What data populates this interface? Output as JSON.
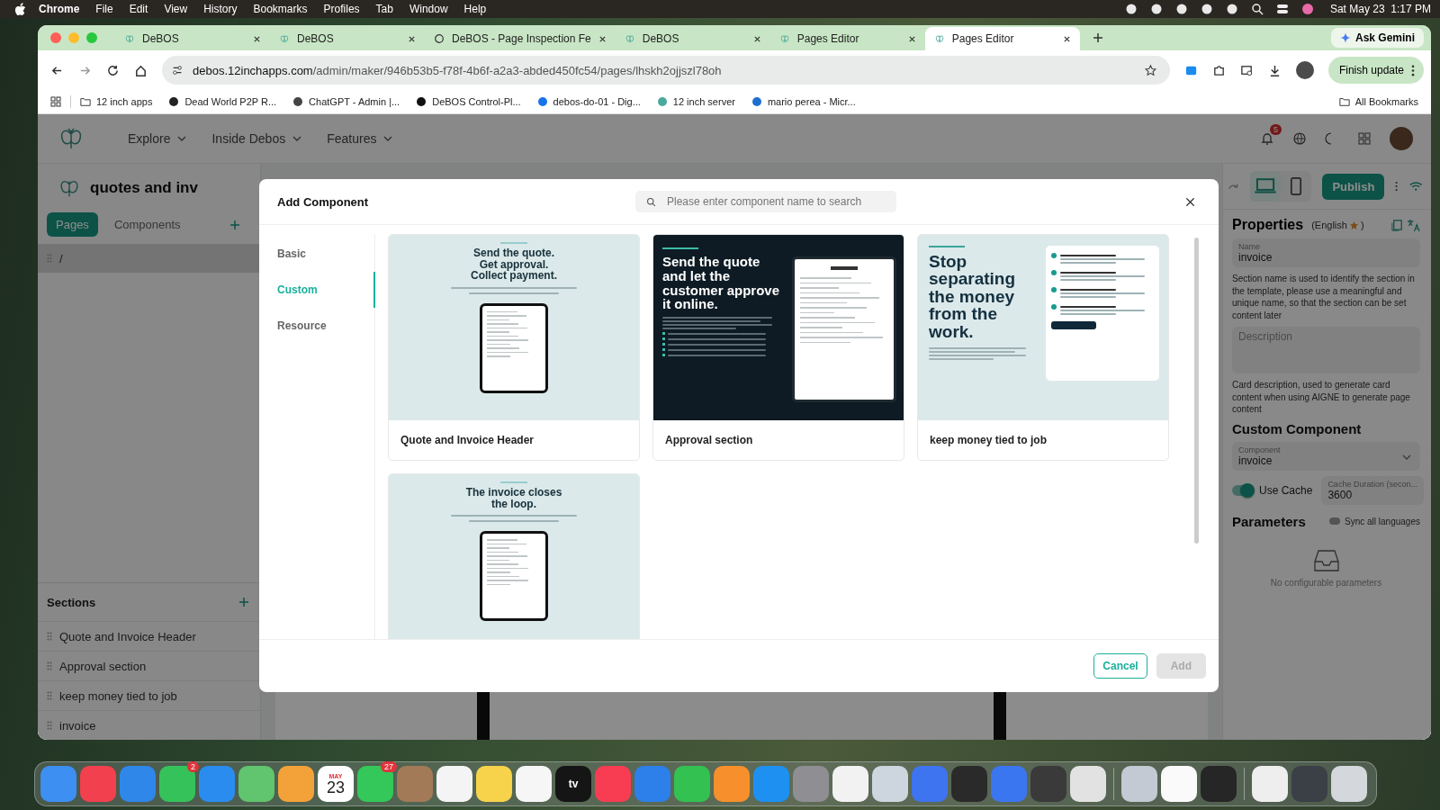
{
  "menu_bar": {
    "app": "Chrome",
    "menus": [
      "File",
      "Edit",
      "View",
      "History",
      "Bookmarks",
      "Profiles",
      "Tab",
      "Window",
      "Help"
    ],
    "clock": "Sat May 23  1:17 PM"
  },
  "browser": {
    "tabs": [
      {
        "label": "DeBOS",
        "selected": false
      },
      {
        "label": "DeBOS",
        "selected": false
      },
      {
        "label": "DeBOS - Page Inspection Fe",
        "selected": false
      },
      {
        "label": "DeBOS",
        "selected": false
      },
      {
        "label": "Pages Editor",
        "selected": false
      },
      {
        "label": "Pages Editor",
        "selected": true
      }
    ],
    "ask_gemini": "Ask Gemini",
    "url_host": "debos.12inchapps.com",
    "url_path": "/admin/maker/946b53b5-f78f-4b6f-a2a3-abded450fc54/pages/lhskh2ojjszl78oh",
    "finish_update": "Finish update",
    "bookmarks": [
      "12 inch apps",
      "Dead World P2P R...",
      "ChatGPT - Admin |...",
      "DeBOS Control-Pl...",
      "debos-do-01 - Dig...",
      "12 inch server",
      "mario perea - Micr..."
    ],
    "all_bookmarks": "All Bookmarks"
  },
  "header": {
    "nav": [
      "Explore",
      "Inside Debos",
      "Features"
    ],
    "notification_count": "5"
  },
  "left_panel": {
    "site_title": "quotes and inv",
    "tabs": [
      {
        "label": "Pages",
        "selected": true
      },
      {
        "label": "Components",
        "selected": false
      }
    ],
    "pages": [
      {
        "label": "/",
        "selected": true
      }
    ],
    "sections_title": "Sections",
    "sections": [
      "Quote and Invoice Header",
      "Approval section",
      "keep money tied to job",
      "invoice"
    ]
  },
  "right_panel": {
    "publish": "Publish",
    "title": "Properties",
    "language": "(English",
    "language_end": ")",
    "name_field": {
      "label": "Name",
      "value": "invoice"
    },
    "name_help": "Section name is used to identify the section in the template, please use a meaningful and unique name, so that the section can be set content later",
    "description_field": {
      "placeholder": "Description"
    },
    "description_help": "Card description, used to generate card content when using AIGNE to generate page content",
    "custom_title": "Custom Component",
    "component_field": {
      "label": "Component",
      "value": "invoice"
    },
    "use_cache": {
      "label": "Use Cache",
      "on": true
    },
    "cache_field": {
      "label": "Cache Duration (secon...",
      "value": "3600"
    },
    "parameters_title": "Parameters",
    "sync": {
      "label": "Sync all languages",
      "on": false
    },
    "empty_text": "No configurable parameters"
  },
  "modal": {
    "title": "Add Component",
    "search": {
      "placeholder": "Please enter component name to search"
    },
    "categories": [
      {
        "label": "Basic",
        "selected": false
      },
      {
        "label": "Custom",
        "selected": true
      },
      {
        "label": "Resource",
        "selected": false
      }
    ],
    "cards": [
      {
        "title": "Quote and Invoice Header",
        "preview": {
          "kind": "doc-center",
          "headline": "Send the quote. Get approval. Collect payment."
        }
      },
      {
        "title": "Approval section",
        "preview": {
          "kind": "dark-split",
          "headline": "Send the quote and let the customer approve it online."
        }
      },
      {
        "title": "keep money tied to job",
        "preview": {
          "kind": "light-split",
          "headline": "Stop separating the money from the work."
        }
      },
      {
        "preview": {
          "kind": "doc-center",
          "headline": "The invoice closes the loop."
        }
      }
    ],
    "cancel": "Cancel",
    "add": {
      "label": "Add",
      "disabled": true
    }
  },
  "dock": [
    {
      "kind": "app",
      "color": "#3d8ff2"
    },
    {
      "kind": "app",
      "color": "#f2404e"
    },
    {
      "kind": "app",
      "color": "#2f87ea"
    },
    {
      "kind": "app",
      "color": "#35c25a",
      "badge": "2"
    },
    {
      "kind": "app",
      "color": "#2b8cf0"
    },
    {
      "kind": "app",
      "color": "#61c46e"
    },
    {
      "kind": "app",
      "color": "#f3a23a"
    },
    {
      "kind": "calendar",
      "month": "MAY",
      "day": "23"
    },
    {
      "kind": "app",
      "color": "#34c759",
      "badge": "27"
    },
    {
      "kind": "app",
      "color": "#a37a58"
    },
    {
      "kind": "app",
      "color": "#f4f4f4"
    },
    {
      "kind": "app",
      "color": "#f7d34c"
    },
    {
      "kind": "app",
      "color": "#f6f6f6"
    },
    {
      "kind": "app",
      "color": "#151515",
      "label": "tv"
    },
    {
      "kind": "app",
      "color": "#f83c51"
    },
    {
      "kind": "app",
      "color": "#2d7fe9"
    },
    {
      "kind": "app",
      "color": "#33c152"
    },
    {
      "kind": "app",
      "color": "#f7902c"
    },
    {
      "kind": "app",
      "color": "#1e90f2"
    },
    {
      "kind": "app",
      "color": "#8e8e93"
    },
    {
      "kind": "app",
      "color": "#f2f2f2"
    },
    {
      "kind": "app",
      "color": "#cdd5df"
    },
    {
      "kind": "app",
      "color": "#3e74ef"
    },
    {
      "kind": "app",
      "color": "#2a2a2a"
    },
    {
      "kind": "app",
      "color": "#3a76f0"
    },
    {
      "kind": "app",
      "color": "#3a3a3a"
    },
    {
      "kind": "app",
      "color": "#e2e2e2"
    },
    {
      "kind": "separator"
    },
    {
      "kind": "app",
      "color": "#c3cad3"
    },
    {
      "kind": "app",
      "color": "#fafafa"
    },
    {
      "kind": "app",
      "color": "#262626"
    },
    {
      "kind": "separator"
    },
    {
      "kind": "app",
      "color": "#eeeeee"
    },
    {
      "kind": "app",
      "color": "#3b3f46"
    },
    {
      "kind": "app",
      "color": "#d4d7db"
    }
  ]
}
